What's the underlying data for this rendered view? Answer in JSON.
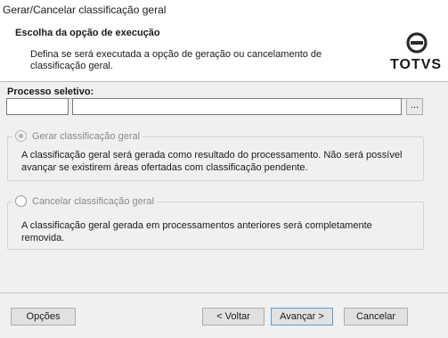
{
  "window": {
    "title": "Gerar/Cancelar classificação geral"
  },
  "header": {
    "title": "Escolha da opção de execução",
    "description": "Defina se será executada a opção de geração ou cancelamento de classificação geral.",
    "logo_text": "TOTVS",
    "logo_icon": "totvs-logo-icon"
  },
  "process": {
    "label": "Processo seletivo:",
    "code_value": "",
    "description_value": "",
    "lookup_label": "..."
  },
  "options": {
    "generate": {
      "label": "Gerar classificação geral",
      "selected": true,
      "enabled": false,
      "text": "A classificação geral será gerada como resultado do processamento. Não será possível avançar se existirem áreas ofertadas com classificação pendente."
    },
    "cancel": {
      "label": "Cancelar classificação geral",
      "selected": false,
      "enabled": false,
      "text": "A classificação geral gerada em processamentos anteriores será completamente removida."
    }
  },
  "footer": {
    "options_label": "Opções",
    "back_label": "< Voltar",
    "next_label": "Avançar >",
    "cancel_label": "Cancelar"
  },
  "colors": {
    "background": "#f0f0f0",
    "header_bg": "#ffffff",
    "default_button_border": "#5e9bd6",
    "disabled_text": "#8a8a8a"
  }
}
